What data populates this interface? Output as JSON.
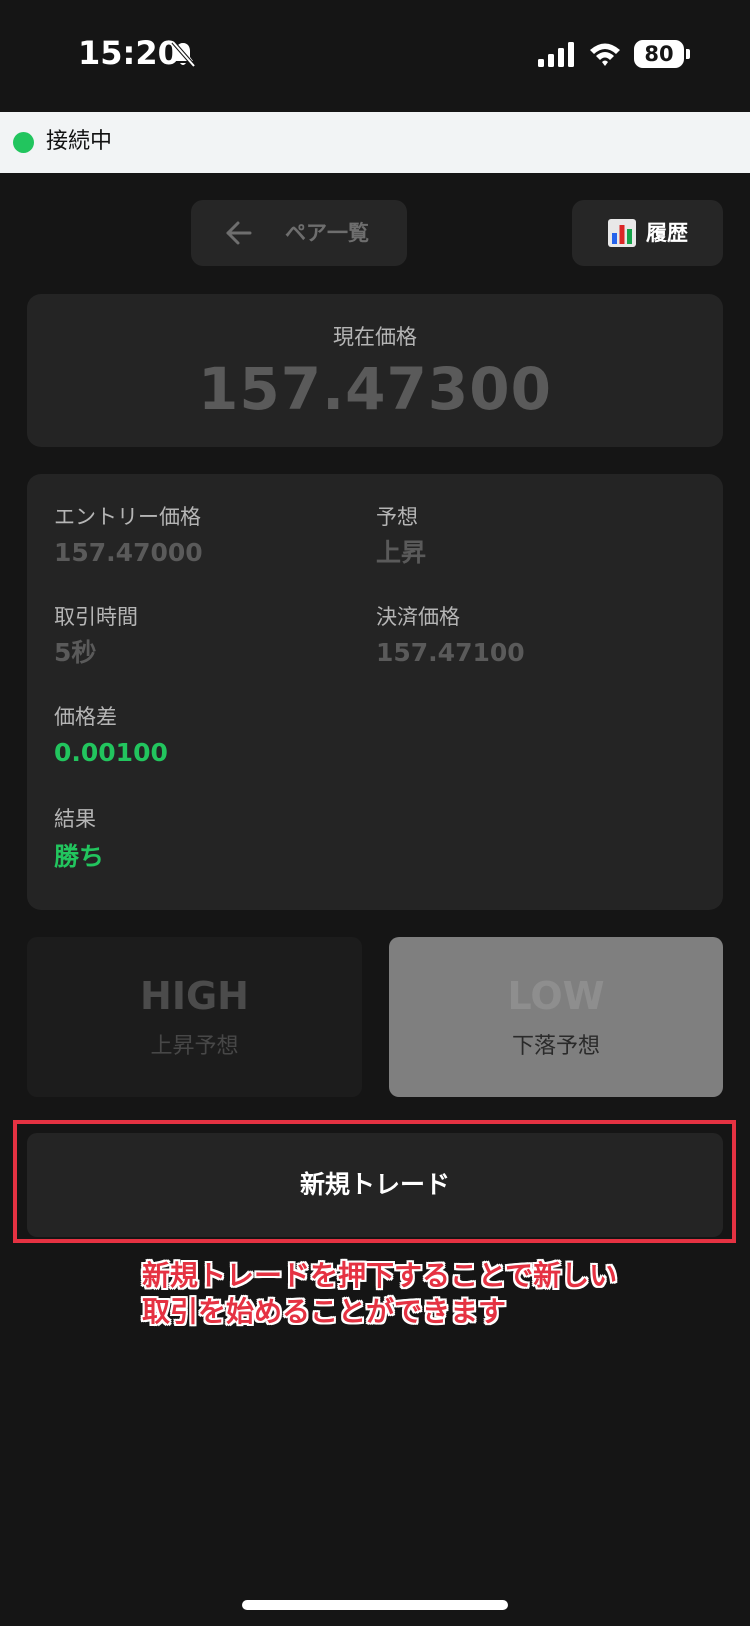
{
  "status_bar": {
    "time": "15:20",
    "battery": "80",
    "icons": [
      "bell-slash-icon",
      "signal-icon",
      "wifi-icon",
      "battery-icon"
    ]
  },
  "connection": {
    "status": "接続中",
    "dot_color": "#22c55e"
  },
  "nav": {
    "pairs_label": "ペア一覧",
    "pairs_icon": "arrow-left-icon",
    "history_label": "履歴",
    "history_icon": "bar-chart-icon"
  },
  "price_card": {
    "caption": "現在価格",
    "value": "157.47300"
  },
  "details": {
    "entry_price": {
      "label": "エントリー価格",
      "value": "157.47000"
    },
    "prediction": {
      "label": "予想",
      "value": "上昇"
    },
    "trade_time": {
      "label": "取引時間",
      "value": "5秒"
    },
    "settle_price": {
      "label": "決済価格",
      "value": "157.47100"
    },
    "price_diff": {
      "label": "価格差",
      "value": "0.00100"
    },
    "result": {
      "label": "結果",
      "value": "勝ち"
    }
  },
  "bets": {
    "high": {
      "title": "HIGH",
      "sub": "上昇予想"
    },
    "low": {
      "title": "LOW",
      "sub": "下落予想"
    }
  },
  "new_trade": {
    "label": "新規トレード"
  },
  "annotation": {
    "line1": "新規トレードを押下することで新しい",
    "line2": "取引を始めることができます",
    "color": "#e53242"
  },
  "colors": {
    "background": "#151515",
    "card": "#242424",
    "accent_green": "#22c55e",
    "highlight_red": "#e53242"
  }
}
